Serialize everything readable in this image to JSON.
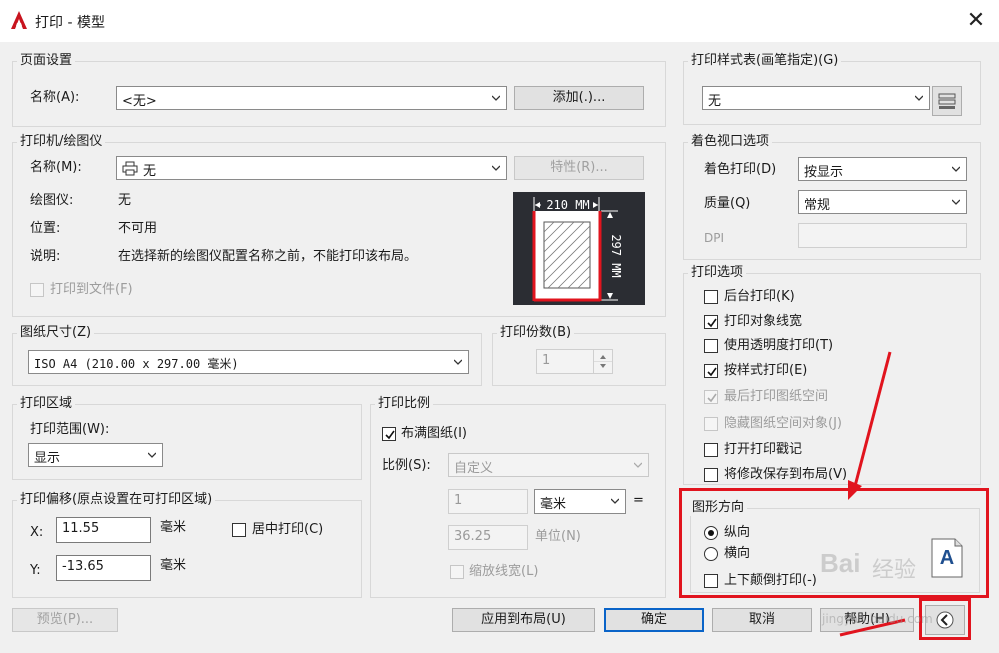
{
  "window": {
    "title": "打印 - 模型",
    "close_glyph": "✕"
  },
  "page_setup": {
    "group": "页面设置",
    "name_label": "名称(A):",
    "name_value": "<无>",
    "add_button": "添加(.)..."
  },
  "printer": {
    "group": "打印机/绘图仪",
    "name_label": "名称(M):",
    "name_value": "无",
    "properties_button": "特性(R)...",
    "plotter_label": "绘图仪:",
    "plotter_value": "无",
    "location_label": "位置:",
    "location_value": "不可用",
    "description_label": "说明:",
    "description_value": "在选择新的绘图仪配置名称之前，不能打印该布局。",
    "print_to_file": "打印到文件(F)",
    "preview_width": "210 MM",
    "preview_height": "297 MM"
  },
  "paper_size": {
    "group": "图纸尺寸(Z)",
    "value": "ISO A4 (210.00 x 297.00 毫米)"
  },
  "copies": {
    "group": "打印份数(B)",
    "value": "1"
  },
  "plot_area": {
    "group": "打印区域",
    "what_label": "打印范围(W):",
    "what_value": "显示"
  },
  "plot_offset": {
    "group": "打印偏移(原点设置在可打印区域)",
    "x_label": "X:",
    "x_value": "11.55",
    "y_label": "Y:",
    "y_value": "-13.65",
    "unit": "毫米",
    "center": "居中打印(C)"
  },
  "plot_scale": {
    "group": "打印比例",
    "fit_to_paper": "布满图纸(I)",
    "scale_label": "比例(S):",
    "scale_value": "自定义",
    "value1": "1",
    "unit1": "毫米",
    "equals": "=",
    "value2": "36.25",
    "unit2": "单位(N)",
    "scale_lineweights": "缩放线宽(L)"
  },
  "plot_style_table": {
    "group": "打印样式表(画笔指定)(G)",
    "value": "无"
  },
  "shaded_viewport": {
    "group": "着色视口选项",
    "shade_label": "着色打印(D)",
    "shade_value": "按显示",
    "quality_label": "质量(Q)",
    "quality_value": "常规",
    "dpi_label": "DPI"
  },
  "plot_options": {
    "group": "打印选项",
    "items": [
      {
        "label": "后台打印(K)",
        "checked": false,
        "disabled": false
      },
      {
        "label": "打印对象线宽",
        "checked": true,
        "disabled": false
      },
      {
        "label": "使用透明度打印(T)",
        "checked": false,
        "disabled": false
      },
      {
        "label": "按样式打印(E)",
        "checked": true,
        "disabled": false
      },
      {
        "label": "最后打印图纸空间",
        "checked": true,
        "disabled": true
      },
      {
        "label": "隐藏图纸空间对象(J)",
        "checked": false,
        "disabled": true
      },
      {
        "label": "打开打印戳记",
        "checked": false,
        "disabled": false
      },
      {
        "label": "将修改保存到布局(V)",
        "checked": false,
        "disabled": false
      }
    ]
  },
  "orientation": {
    "group": "图形方向",
    "portrait": "纵向",
    "landscape": "横向",
    "upside_down": "上下颠倒打印(-)",
    "icon_letter": "A"
  },
  "footer": {
    "preview": "预览(P)...",
    "apply": "应用到布局(U)",
    "ok": "确定",
    "cancel": "取消",
    "help": "帮助(H)"
  },
  "watermark": {
    "brand": "Bai",
    "brand_cn": "经验",
    "url": "jingyan.baidu.com"
  },
  "colors": {
    "highlight_red": "#e1141e",
    "preview_bg": "#2b2d33"
  }
}
